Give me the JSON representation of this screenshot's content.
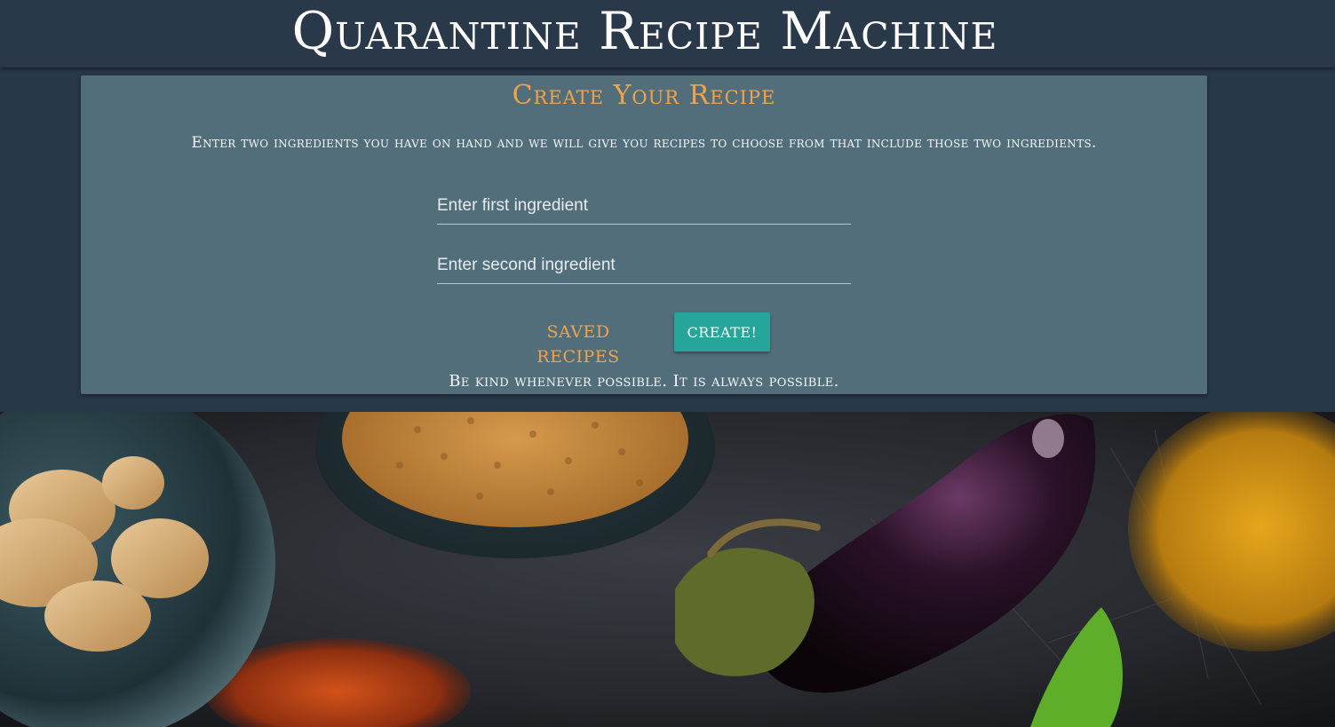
{
  "header": {
    "title": "Quarantine Recipe Machine"
  },
  "card": {
    "title": "Create Your Recipe",
    "intro": "Enter two ingredients you have on hand and we will give you recipes to choose from that include those two ingredients.",
    "first_ingredient": {
      "value": "",
      "placeholder": "Enter first ingredient"
    },
    "second_ingredient": {
      "value": "",
      "placeholder": "Enter second ingredient"
    },
    "saved_recipes_label": "SAVED RECIPES",
    "create_label": "CREATE!",
    "quote": "Be kind whenever possible. It is always possible."
  },
  "colors": {
    "header_bg": "#293949",
    "card_bg": "#536e7b",
    "accent_orange": "#f0a24c",
    "button_teal": "#26a69a"
  },
  "background_image": {
    "subject": "spices and vegetables on a dark surface",
    "items": [
      "ginger-root",
      "fenugreek-seeds-bowl",
      "eggplant",
      "turmeric-powder",
      "paprika-powder",
      "green-leaf"
    ]
  }
}
